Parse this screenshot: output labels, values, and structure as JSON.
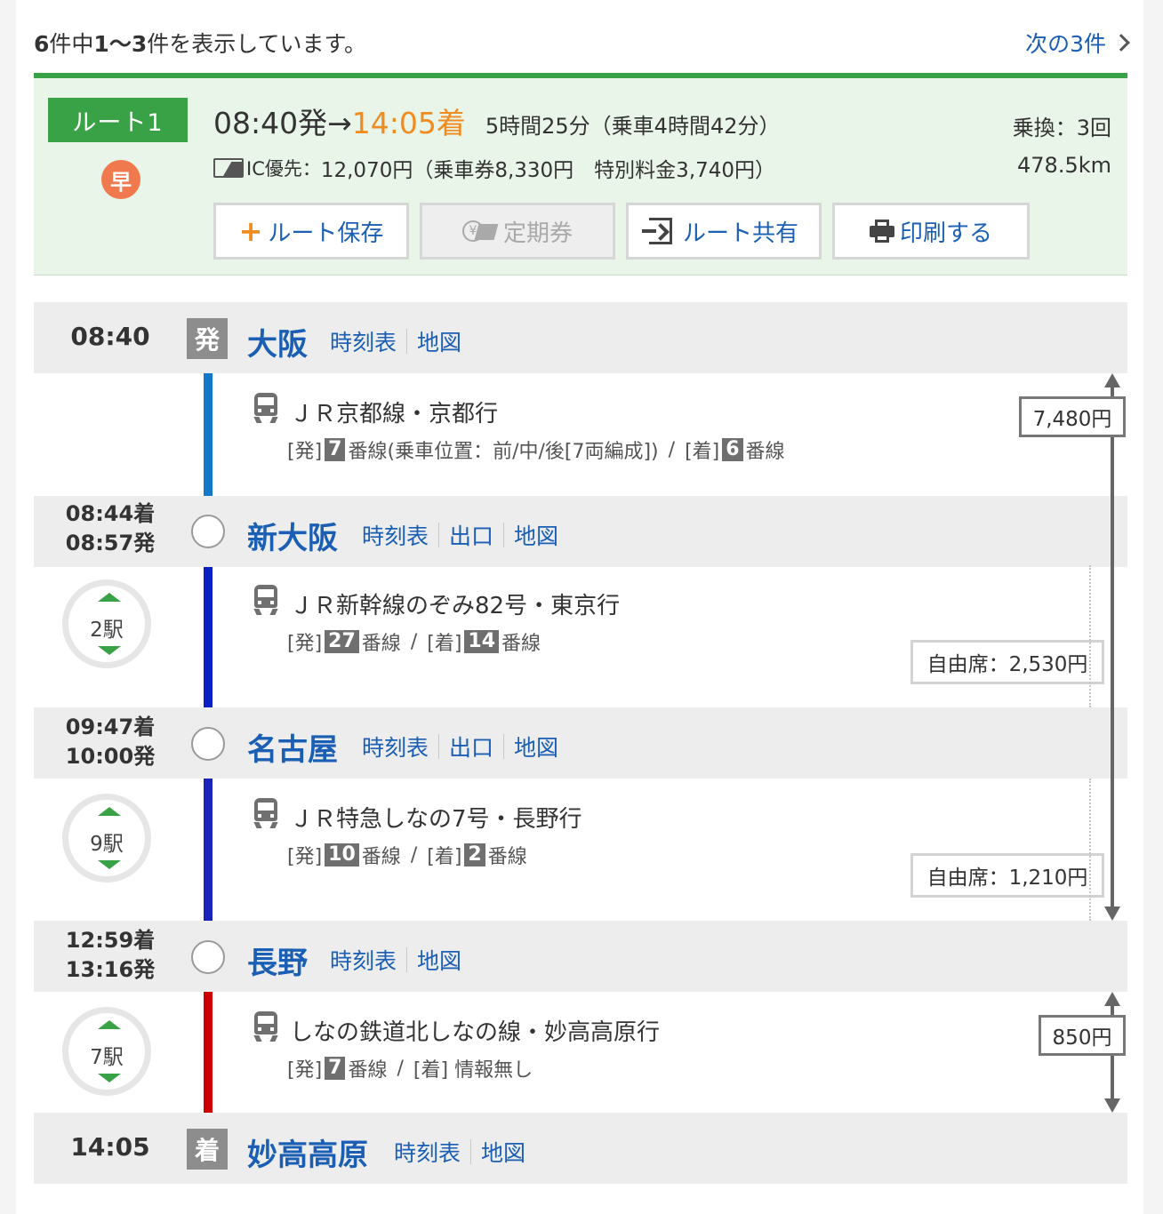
{
  "results": {
    "total": "6",
    "total_suffix": "件中",
    "range": "1〜3",
    "range_suffix": "件を表示しています。",
    "next_label": "次の3件"
  },
  "summary": {
    "route_label": "ルート1",
    "early_badge": "早",
    "depart": "08:40発",
    "arrow": "→",
    "arrive": "14:05着",
    "duration": "5時間25分（乗車4時間42分）",
    "fare_prefix": "IC優先：",
    "fare": "12,070円（乗車券8,330円　特別料金3,740円）",
    "transfers": "乗換：3回",
    "distance": "478.5km"
  },
  "buttons": {
    "save": "ルート保存",
    "commuter_pass": "定期券",
    "share": "ルート共有",
    "print": "印刷する"
  },
  "stations": [
    {
      "time": "08:40",
      "badge": "発",
      "name": "大阪",
      "links": [
        "時刻表",
        "地図"
      ]
    },
    {
      "arrive": "08:44着",
      "depart": "08:57発",
      "name": "新大阪",
      "links": [
        "時刻表",
        "出口",
        "地図"
      ]
    },
    {
      "arrive": "09:47着",
      "depart": "10:00発",
      "name": "名古屋",
      "links": [
        "時刻表",
        "出口",
        "地図"
      ]
    },
    {
      "arrive": "12:59着",
      "depart": "13:16発",
      "name": "長野",
      "links": [
        "時刻表",
        "地図"
      ]
    },
    {
      "time": "14:05",
      "badge": "着",
      "name": "妙高高原",
      "links": [
        "時刻表",
        "地図"
      ]
    }
  ],
  "segments": [
    {
      "train": "ＪＲ京都線・京都行",
      "dep_label": "[発]",
      "dep_no": "7",
      "dep_suffix": "番線(乗車位置：前/中/後[7両編成])",
      "mid": "/",
      "arr_label": "[着]",
      "arr_no": "6",
      "arr_suffix": "番線",
      "line_color": "#1478c8"
    },
    {
      "train": "ＪＲ新幹線のぞみ82号・東京行",
      "stops": "2駅",
      "dep_label": "[発]",
      "dep_no": "27",
      "dep_suffix": "番線",
      "mid": "/",
      "arr_label": "[着]",
      "arr_no": "14",
      "arr_suffix": "番線",
      "seat_fare": "自由席：2,530円",
      "line_color": "#0a1fc4"
    },
    {
      "train": "ＪＲ特急しなの7号・長野行",
      "stops": "9駅",
      "dep_label": "[発]",
      "dep_no": "10",
      "dep_suffix": "番線",
      "mid": "/",
      "arr_label": "[着]",
      "arr_no": "2",
      "arr_suffix": "番線",
      "seat_fare": "自由席：1,210円",
      "line_color": "#1a24b8"
    },
    {
      "train": "しなの鉄道北しなの線・妙高高原行",
      "stops": "7駅",
      "dep_label": "[発]",
      "dep_no": "7",
      "dep_suffix": "番線",
      "mid": "/",
      "arr_label": "[着]",
      "arr_info": "情報無し",
      "line_color": "#cc0000"
    }
  ],
  "fares": {
    "jr": "7,480円",
    "shinano": "850円"
  }
}
